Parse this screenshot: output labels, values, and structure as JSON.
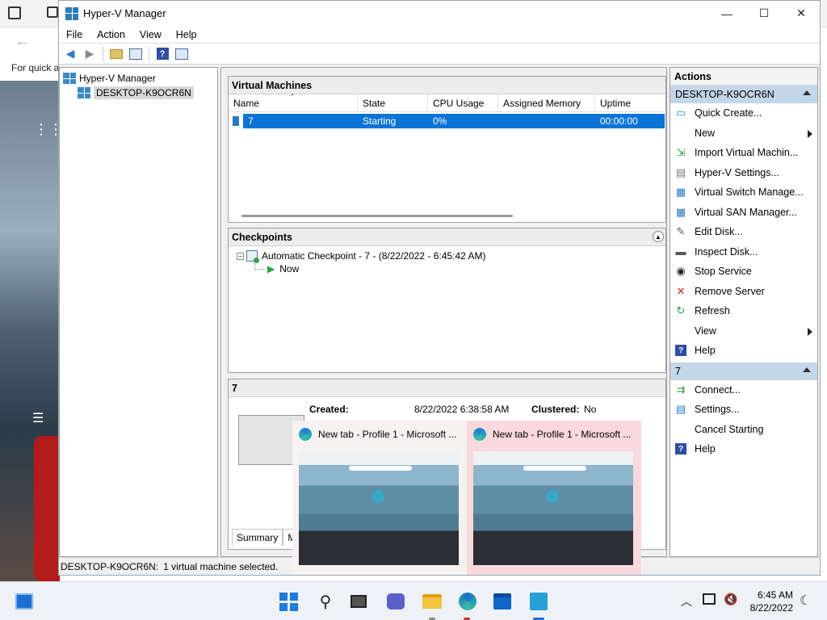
{
  "background": {
    "quick_text": "For quick a"
  },
  "window": {
    "title": "Hyper-V Manager",
    "minimize_icon": "—",
    "maximize_icon": "☐",
    "close_icon": "✕"
  },
  "menu": {
    "file": "File",
    "action": "Action",
    "view": "View",
    "help": "Help"
  },
  "tree": {
    "root": "Hyper-V Manager",
    "host": "DESKTOP-K9OCR6N"
  },
  "vms": {
    "title": "Virtual Machines",
    "columns": [
      "Name",
      "State",
      "CPU Usage",
      "Assigned Memory",
      "Uptime"
    ],
    "rows": [
      {
        "name": "7",
        "state": "Starting",
        "cpu": "0%",
        "memory": "",
        "uptime": "00:00:00"
      }
    ]
  },
  "checkpoints": {
    "title": "Checkpoints",
    "item": "Automatic Checkpoint - 7 - (8/22/2022 - 6:45:42 AM)",
    "now": "Now"
  },
  "details": {
    "title": "7",
    "created_label": "Created:",
    "created_value": "8/22/2022 6:38:58 AM",
    "clustered_label": "Clustered:",
    "clustered_value": "No",
    "tabs": [
      "Summary",
      "Mem"
    ]
  },
  "actions": {
    "title": "Actions",
    "host_group": "DESKTOP-K9OCR6N",
    "host_items": [
      "Quick Create...",
      "New",
      "Import Virtual Machin...",
      "Hyper-V Settings...",
      "Virtual Switch Manage...",
      "Virtual SAN Manager...",
      "Edit Disk...",
      "Inspect Disk...",
      "Stop Service",
      "Remove Server",
      "Refresh",
      "View",
      "Help"
    ],
    "vm_group": "7",
    "vm_items": [
      "Connect...",
      "Settings...",
      "Cancel Starting",
      "Help"
    ]
  },
  "status": {
    "host": "DESKTOP-K9OCR6N:",
    "text": "1 virtual machine selected."
  },
  "previews": [
    {
      "title": "New tab - Profile 1 - Microsoft ..."
    },
    {
      "title": "New tab - Profile 1 - Microsoft ..."
    }
  ],
  "taskbar": {
    "time": "6:45 AM",
    "date": "8/22/2022"
  },
  "colors": {
    "selection": "#0a74d6",
    "group_header": "#c4d6ea"
  }
}
